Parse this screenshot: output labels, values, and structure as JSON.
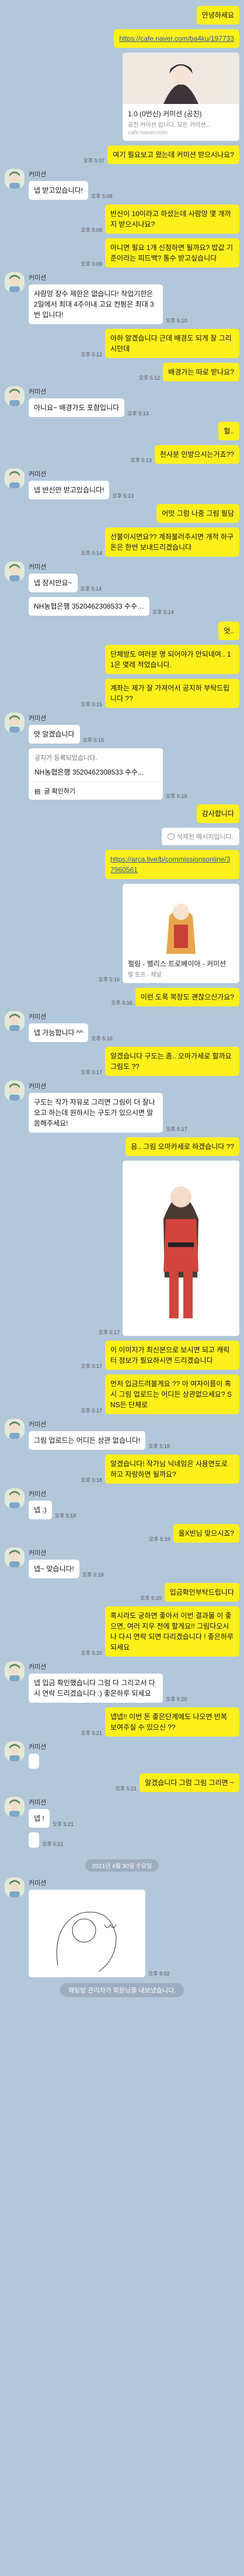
{
  "colors": {
    "background": "#b2c7da",
    "mine": "#fef01b",
    "theirs": "#ffffff"
  },
  "contact_name": "커미션",
  "messages": [
    {
      "id": "m1",
      "side": "me",
      "text": "안녕하세요",
      "time": ""
    },
    {
      "id": "m2",
      "side": "me",
      "type": "link",
      "text": "https://cafe.naver.com/ba4ku/197733",
      "time": ""
    },
    {
      "id": "m3",
      "side": "me",
      "type": "card",
      "card_title": "1.0 (0번신) 커미션 (공진)",
      "card_sub": "공진 커미션 입니다. 모든 커미션...",
      "card_url": "cafe.naver.com",
      "time": ""
    },
    {
      "id": "m4",
      "side": "me",
      "text": "여기 필요보고 왔는데 커미션 받으시나요?",
      "time": "오후 5:07"
    },
    {
      "id": "m5",
      "side": "them",
      "text": "넵 받고있습니다!",
      "time": "오후 5:08",
      "show_name": true
    },
    {
      "id": "m6",
      "side": "me",
      "text": "반신이 10이라고 하셨는데 사람망 몇 개까지 받으시나요?",
      "time": "오후 5:08"
    },
    {
      "id": "m7",
      "side": "me",
      "text": "아니면 필요 1개 신청하면 될까요? 밥값 기준이라는 피드백? 통수 받고싶습니다",
      "time": "오후 5:09"
    },
    {
      "id": "m8",
      "side": "them",
      "text": "사람망 장수 제한은 없습니다! 작업기한은 2일에서 최대 4주이내 고요 컨펌은 최대 3번 입니다!",
      "time": "오후 5:10",
      "show_name": true
    },
    {
      "id": "m9",
      "side": "me",
      "text": "아하 알겠습니다 근데 배경도 되게 잘 그리시던데",
      "time": "오후 5:12"
    },
    {
      "id": "m10",
      "side": "me",
      "text": "배경가는 따로 받나요?",
      "time": "오후 5:12"
    },
    {
      "id": "m11",
      "side": "them",
      "text": "아니요~ 배경가도 포함입니다",
      "time": "오후 5:13",
      "show_name": true
    },
    {
      "id": "m12",
      "side": "me",
      "text": "헐..",
      "time": ""
    },
    {
      "id": "m13",
      "side": "me",
      "text": "천사분 인방으시는거죠??",
      "time": "오후 5:13"
    },
    {
      "id": "m14",
      "side": "them",
      "text": "넵 반신만 받고있습니다!",
      "time": "오후 5:13",
      "show_name": true
    },
    {
      "id": "m15",
      "side": "me",
      "text": "어맛 그럼 나중 그림 필담",
      "time": ""
    },
    {
      "id": "m16",
      "side": "me",
      "text": "선불이시면요?? 계좌불러주시면 개적 하구 돈은 한번 보내드리겠습니다",
      "time": "오후 5:14"
    },
    {
      "id": "m17",
      "side": "them",
      "text": "넵 잠시만요~",
      "time": "오후 5:14",
      "show_name": true
    },
    {
      "id": "m18",
      "side": "them",
      "text": "NH농협은행 3520462308533 수수…",
      "time": "오후 5:14",
      "show_name": false
    },
    {
      "id": "m19",
      "side": "me",
      "text": "엇..",
      "time": ""
    },
    {
      "id": "m20",
      "side": "me",
      "text": "단체방도 여러분 명 되어야가 안되네여.. 11은 몇레 적었습니다.",
      "time": ""
    },
    {
      "id": "m21",
      "side": "me",
      "text": "계좌는 제가 잘 가져어서 공지하 부탁드립니다 ??",
      "time": "오후 5:15"
    },
    {
      "id": "m22",
      "side": "them",
      "text": "앗 알겠습니다",
      "time": "오후 5:15",
      "show_name": true
    },
    {
      "id": "m23",
      "side": "them",
      "type": "bank",
      "bank_head": "공지가 등록되었습니다.",
      "bank_body": "NH농협은행 3520462308533 수수...",
      "bank_foot": "글 확인하기",
      "time": "오후 5:16",
      "show_name": false
    },
    {
      "id": "m24",
      "side": "me",
      "text": "감사합니다",
      "time": ""
    },
    {
      "id": "m25",
      "side": "me",
      "type": "deleted",
      "text": "삭제된 메시지입니다.",
      "time": ""
    },
    {
      "id": "m26",
      "side": "me",
      "type": "link",
      "text": "https://arca.live/b/commissionsonline/37960561",
      "time": ""
    },
    {
      "id": "m27",
      "side": "me",
      "type": "image",
      "caption_title": "펄링 - 밸리스 트로베이아 - 커미션",
      "caption_sub": "펄 토프 · 채널",
      "time": "오후 5:16"
    },
    {
      "id": "m28",
      "side": "me",
      "text": "이런 도록 복장도 괜찮으신가요?",
      "time": "오후 5:16"
    },
    {
      "id": "m29",
      "side": "them",
      "text": "넵 가능합니다 ^^",
      "time": "오후 5:16",
      "show_name": true
    },
    {
      "id": "m30",
      "side": "me",
      "text": "알겠습니다 구도는 좀.. 오마가세로 할까요 그림도 ??",
      "time": "오후 5:17"
    },
    {
      "id": "m31",
      "side": "them",
      "text": "구도는 작가 자유로 그리면 그림이 더 잘나오고 하는데 원하시는 구도가 있으시면 말씀해주세요!",
      "time": "오후 5:17",
      "show_name": true
    },
    {
      "id": "m32",
      "side": "me",
      "text": "음.. 그림 오마카세로 하겠습니다 ??",
      "time": ""
    },
    {
      "id": "m33",
      "side": "me",
      "type": "image2",
      "time": "오후 5:17"
    },
    {
      "id": "m34",
      "side": "me",
      "text": "이 이미지가 최신본으로 보시면 되고 캐릭터 정보가 필요하시면 드리겠습니다",
      "time": "오후 5:17"
    },
    {
      "id": "m35",
      "side": "me",
      "text": "먼저 입금드려볼게요 ?? 아 여자이름이 혹시 그림 업로드는 어디든 상관없으세요? SNS든 단체로",
      "time": "오후 5:17"
    },
    {
      "id": "m36",
      "side": "them",
      "text": "그림 업로드는 어디든 상관 없습니다!",
      "time": "오후 5:18",
      "show_name": true
    },
    {
      "id": "m37",
      "side": "me",
      "text": "알겠습니다! 작가님 닉네임은 사용연도로 하고 자랑하면 될까요?",
      "time": "오후 5:18"
    },
    {
      "id": "m38",
      "side": "them",
      "text": "넵 :)",
      "time": "오후 5:18",
      "show_name": true
    },
    {
      "id": "m39",
      "side": "me",
      "text": "을X빈님 맞으시죠?",
      "time": "오후 5:19"
    },
    {
      "id": "m40",
      "side": "them",
      "text": "넵~ 맞습니다!",
      "time": "오후 5:19",
      "show_name": true
    },
    {
      "id": "m41",
      "side": "me",
      "text": "입금확인부탁드립니다",
      "time": "오후 5:20"
    },
    {
      "id": "m42",
      "side": "me",
      "text": "혹시라도 궁하면 좋아서 이번 결과물 이 좋으면, 여러 지우 전에 할게요!! 그림다오시나 다시 연락 되면 다리겠습니다 ! 좋은하루 되세요",
      "time": "오후 5:20"
    },
    {
      "id": "m43",
      "side": "them",
      "text": "넵 입금 확인했습니다 그럼 다 그리고서 다시 연락 드리겠습니다 :) 좋은하루 되세요",
      "time": "오후 5:20",
      "show_name": true
    },
    {
      "id": "m44",
      "side": "me",
      "text": "넵넵!! 이번 돈 좋은단계에도 나오면 반복 보여주실 수 있으신 ??",
      "time": "오후 5:21"
    },
    {
      "id": "m45",
      "side": "them",
      "text": "",
      "time": "",
      "show_name": true,
      "empty": true
    },
    {
      "id": "m46",
      "side": "me",
      "text": "알겠습니다 그럼 그림 그리면 ~",
      "time": "오후 5:21"
    },
    {
      "id": "m47",
      "side": "them",
      "text": "넵 !",
      "time": "오후 5:21",
      "show_name": true
    },
    {
      "id": "m48",
      "side": "them",
      "text": "",
      "time": "오후 5:21",
      "show_name": false,
      "blank": true
    },
    {
      "id": "d1",
      "type": "date",
      "text": "2021년 4월 30일 수요일"
    },
    {
      "id": "m49",
      "side": "them",
      "type": "sketch",
      "time": "오후 9:02",
      "show_name": true
    },
    {
      "id": "s1",
      "type": "system",
      "text": "채팅방 관리자가 회원님을 내보냈습니다."
    }
  ]
}
